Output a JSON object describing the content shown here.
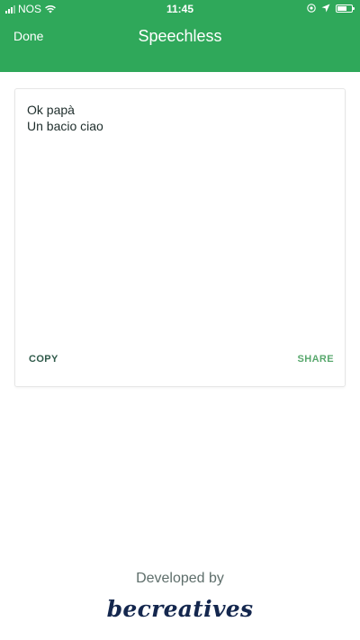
{
  "status_bar": {
    "carrier": "NOS",
    "time": "11:45",
    "battery_level": 0.65
  },
  "nav": {
    "done_label": "Done",
    "title": "Speechless"
  },
  "card": {
    "lines": [
      "Ok papà",
      "Un bacio ciao"
    ],
    "copy_label": "COPY",
    "share_label": "SHARE"
  },
  "footer": {
    "developed_by": "Developed by",
    "brand": "becreatives"
  },
  "colors": {
    "header": "#2fa85a",
    "share": "#58a86d",
    "copy": "#2f5a4a",
    "brand": "#14274e"
  },
  "icons": [
    "signal-icon",
    "wifi-icon",
    "at-icon",
    "location-arrow-icon",
    "battery-icon"
  ]
}
